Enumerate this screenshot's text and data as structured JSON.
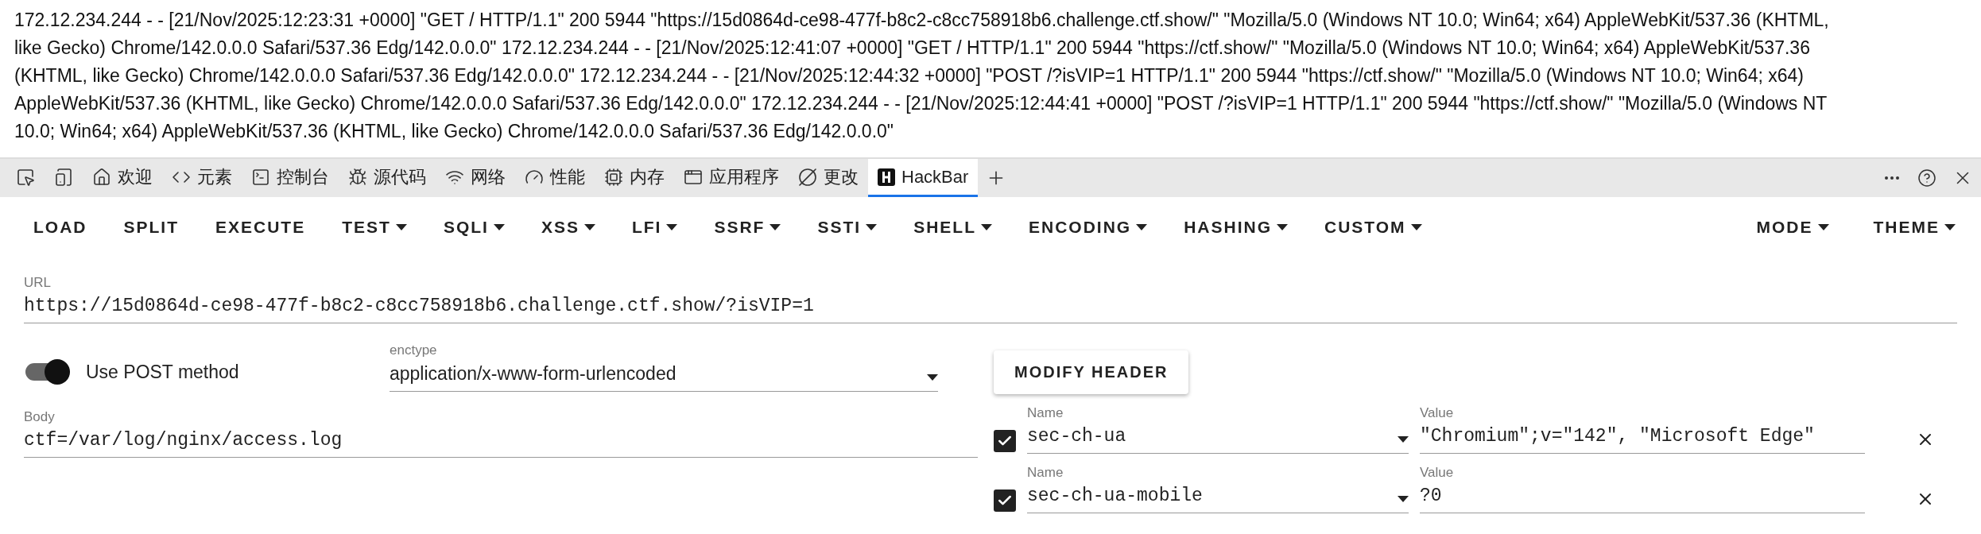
{
  "log": {
    "lines": [
      "172.12.234.244 - - [21/Nov/2025:12:23:31 +0000] \"GET / HTTP/1.1\" 200 5944 \"https://15d0864d-ce98-477f-b8c2-c8cc758918b6.challenge.ctf.show/\" \"Mozilla/5.0 (Windows NT 10.0; Win64; x64) AppleWebKit/537.36 (KHTML,",
      "like Gecko) Chrome/142.0.0.0 Safari/537.36 Edg/142.0.0.0\" 172.12.234.244 - - [21/Nov/2025:12:41:07 +0000] \"GET / HTTP/1.1\" 200 5944 \"https://ctf.show/\" \"Mozilla/5.0 (Windows NT 10.0; Win64; x64) AppleWebKit/537.36",
      "(KHTML, like Gecko) Chrome/142.0.0.0 Safari/537.36 Edg/142.0.0.0\" 172.12.234.244 - - [21/Nov/2025:12:44:32 +0000] \"POST /?isVIP=1 HTTP/1.1\" 200 5944 \"https://ctf.show/\" \"Mozilla/5.0 (Windows NT 10.0; Win64; x64)",
      "AppleWebKit/537.36 (KHTML, like Gecko) Chrome/142.0.0.0 Safari/537.36 Edg/142.0.0.0\" 172.12.234.244 - - [21/Nov/2025:12:44:41 +0000] \"POST /?isVIP=1 HTTP/1.1\" 200 5944 \"https://ctf.show/\" \"Mozilla/5.0 (Windows NT",
      "10.0; Win64; x64) AppleWebKit/537.36 (KHTML, like Gecko) Chrome/142.0.0.0 Safari/537.36 Edg/142.0.0.0\""
    ]
  },
  "devtools_tabs": [
    {
      "kind": "inspect",
      "selected": false
    },
    {
      "kind": "device",
      "selected": false
    },
    {
      "kind": "home",
      "label": "欢迎",
      "selected": false
    },
    {
      "kind": "code",
      "label": "元素",
      "selected": false
    },
    {
      "kind": "console",
      "label": "控制台",
      "selected": false
    },
    {
      "kind": "bug",
      "label": "源代码",
      "selected": false
    },
    {
      "kind": "wifi",
      "label": "网络",
      "selected": false
    },
    {
      "kind": "gauge",
      "label": "性能",
      "selected": false
    },
    {
      "kind": "chip",
      "label": "内存",
      "selected": false
    },
    {
      "kind": "window",
      "label": "应用程序",
      "selected": false
    },
    {
      "kind": "changes",
      "label": "更改",
      "selected": false
    },
    {
      "kind": "hackbar",
      "label": "HackBar",
      "selected": true
    }
  ],
  "toolbar": {
    "left": [
      {
        "label": "LOAD",
        "menu": false
      },
      {
        "label": "SPLIT",
        "menu": false
      },
      {
        "label": "EXECUTE",
        "menu": false
      },
      {
        "label": "TEST",
        "menu": true
      },
      {
        "label": "SQLI",
        "menu": true
      },
      {
        "label": "XSS",
        "menu": true
      },
      {
        "label": "LFI",
        "menu": true
      },
      {
        "label": "SSRF",
        "menu": true
      },
      {
        "label": "SSTI",
        "menu": true
      },
      {
        "label": "SHELL",
        "menu": true
      },
      {
        "label": "ENCODING",
        "menu": true
      },
      {
        "label": "HASHING",
        "menu": true
      },
      {
        "label": "CUSTOM",
        "menu": true
      }
    ],
    "right": [
      {
        "label": "MODE",
        "menu": true
      },
      {
        "label": "THEME",
        "menu": true
      }
    ]
  },
  "url": {
    "label": "URL",
    "value": "https://15d0864d-ce98-477f-b8c2-c8cc758918b6.challenge.ctf.show/?isVIP=1"
  },
  "post": {
    "label": "Use POST method",
    "on": true
  },
  "enctype": {
    "label": "enctype",
    "value": "application/x-www-form-urlencoded"
  },
  "body": {
    "label": "Body",
    "value": "ctf=/var/log/nginx/access.log"
  },
  "modify_header": "MODIFY HEADER",
  "headers": [
    {
      "checked": true,
      "name_label": "Name",
      "name": "sec-ch-ua",
      "value_label": "Value",
      "value": "\"Chromium\";v=\"142\", \"Microsoft Edge\""
    },
    {
      "checked": true,
      "name_label": "Name",
      "name": "sec-ch-ua-mobile",
      "value_label": "Value",
      "value": "?0"
    }
  ]
}
